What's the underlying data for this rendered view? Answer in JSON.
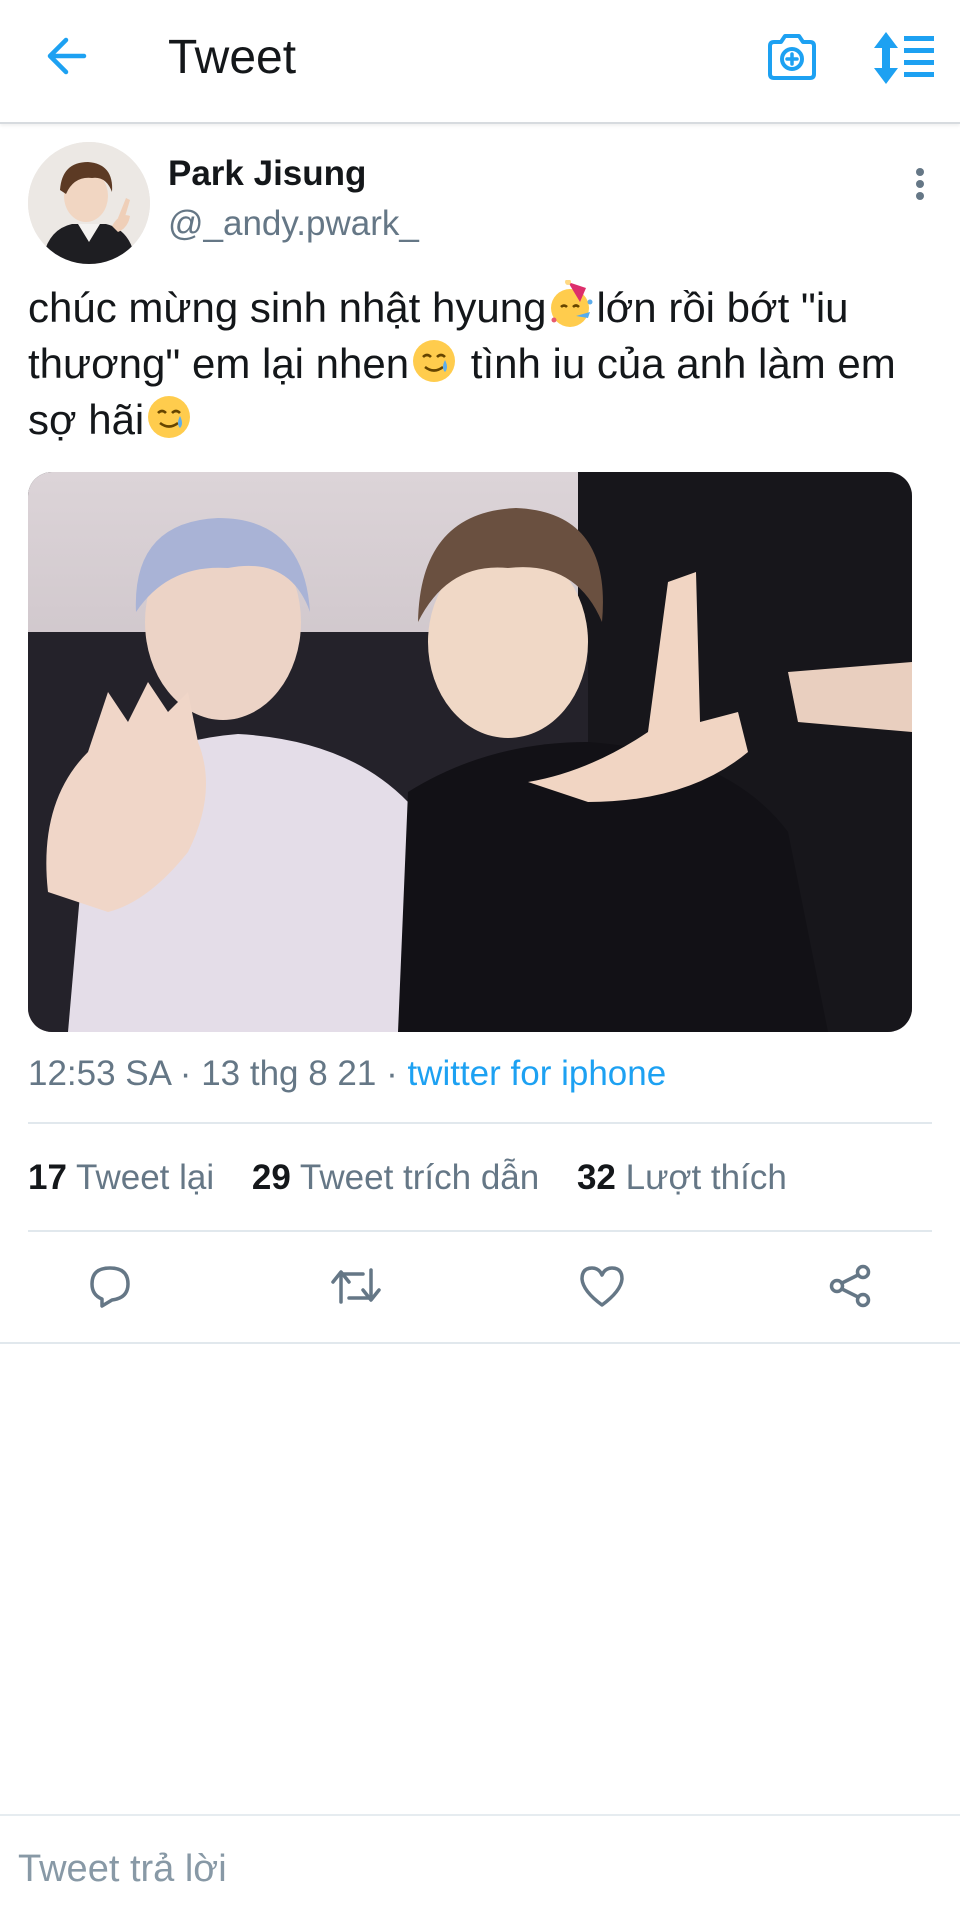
{
  "header": {
    "title": "Tweet",
    "back_icon": "arrow-left-icon",
    "camera_icon": "camera-icon",
    "sort_icon": "sort-icon",
    "accent_color": "#1da1f2"
  },
  "tweet": {
    "author": {
      "display_name": "Park Jisung",
      "handle": "@_andy.pwark_"
    },
    "text": {
      "part1": "chúc mừng sinh nhật hyung",
      "part2": "lớn rồi bớt \"iu thương\" em lại nhen",
      "part3": " tình iu của anh làm em sợ hãi",
      "emoji1": "partying-face-emoji",
      "emoji2": "smiling-face-with-tear-emoji",
      "emoji3": "smiling-face-with-tear-emoji"
    },
    "meta": {
      "time": "12:53 SA",
      "separator": " · ",
      "date": "13 thg 8 21",
      "source": "twitter for iphone"
    },
    "stats": {
      "retweets_count": "17",
      "retweets_label": "Tweet lại",
      "quotes_count": "29",
      "quotes_label": "Tweet trích dẫn",
      "likes_count": "32",
      "likes_label": "Lượt thích"
    },
    "actions": [
      "reply-icon",
      "retweet-icon",
      "like-icon",
      "share-icon"
    ]
  },
  "reply": {
    "placeholder": "Tweet trả lời"
  }
}
